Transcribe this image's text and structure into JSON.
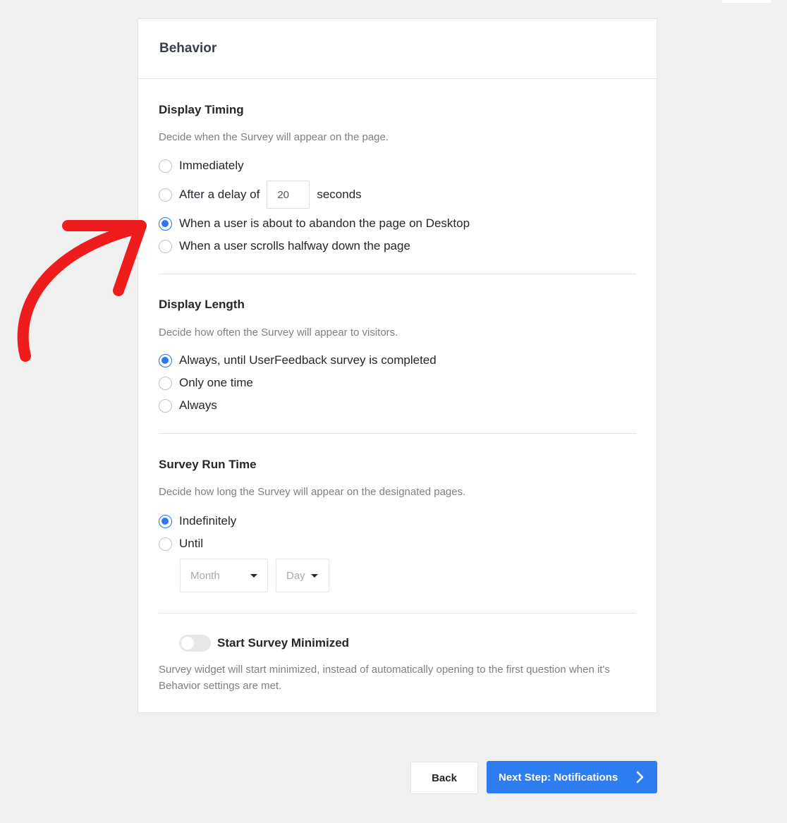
{
  "card": {
    "title": "Behavior"
  },
  "display_timing": {
    "title": "Display Timing",
    "description": "Decide when the Survey will appear on the page.",
    "options": [
      {
        "label": "Immediately",
        "checked": false
      },
      {
        "label_before": "After a delay of",
        "value": "20",
        "label_after": "seconds",
        "checked": false
      },
      {
        "label": "When a user is about to abandon the page on Desktop",
        "checked": true
      },
      {
        "label": "When a user scrolls halfway down the page",
        "checked": false
      }
    ]
  },
  "display_length": {
    "title": "Display Length",
    "description": "Decide how often the Survey will appear to visitors.",
    "options": [
      {
        "label": "Always, until UserFeedback survey is completed",
        "checked": true
      },
      {
        "label": "Only one time",
        "checked": false
      },
      {
        "label": "Always",
        "checked": false
      }
    ]
  },
  "run_time": {
    "title": "Survey Run Time",
    "description": "Decide how long the Survey will appear on the designated pages.",
    "options": [
      {
        "label": "Indefinitely",
        "checked": true
      },
      {
        "label": "Until",
        "checked": false
      }
    ],
    "month_placeholder": "Month",
    "day_placeholder": "Day"
  },
  "minimized": {
    "label": "Start Survey Minimized",
    "enabled": false,
    "description": "Survey widget will start minimized, instead of automatically opening to the first question when it's Behavior settings are met."
  },
  "footer": {
    "back_label": "Back",
    "next_label": "Next Step: Notifications"
  },
  "colors": {
    "accent": "#2d7cf0",
    "annotation_arrow": "#ee1c1c"
  }
}
